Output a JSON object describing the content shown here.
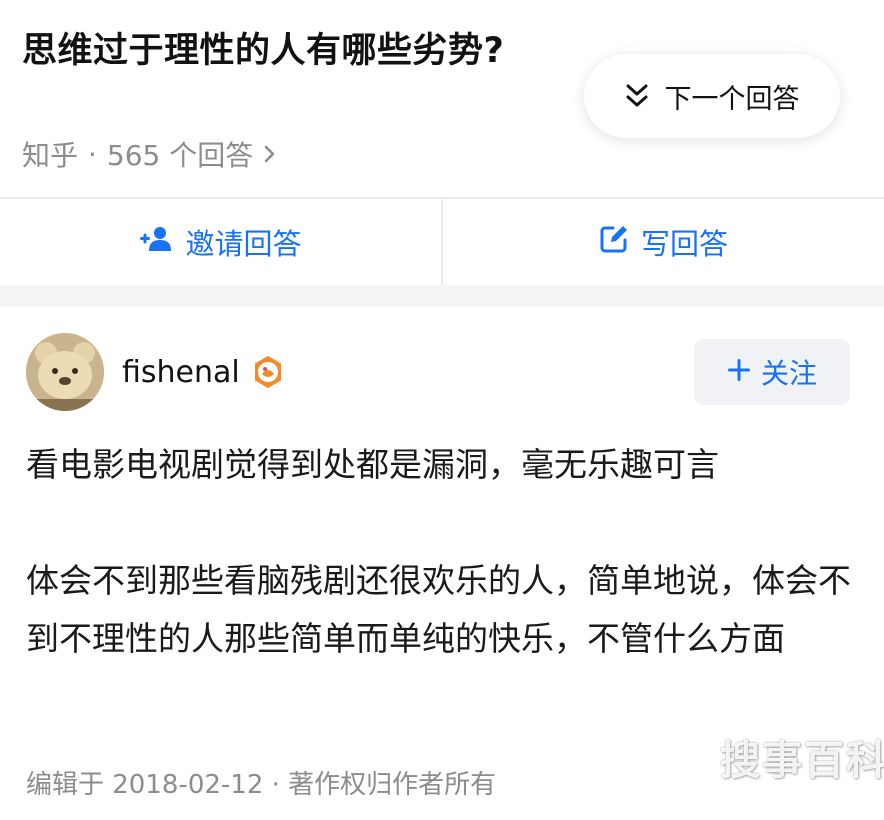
{
  "question": {
    "title": "思维过于理性的人有哪些劣势?",
    "source": "知乎",
    "separator": "·",
    "answer_count": "565 个回答"
  },
  "next_answer": {
    "label": "下一个回答",
    "icon": "double-chevron-down-icon"
  },
  "actions": {
    "invite_label": "邀请回答",
    "invite_icon": "add-person-icon",
    "write_label": "写回答",
    "write_icon": "edit-icon"
  },
  "author": {
    "name": "fishenal",
    "badge_icon": "creator-badge-icon",
    "follow_label": "关注"
  },
  "answer": {
    "paragraphs": [
      "看电影电视剧觉得到处都是漏洞，毫无乐趣可言",
      "体会不到那些看脑残剧还很欢乐的人，简单地说，体会不到不理性的人那些简单而单纯的快乐，不管什么方面"
    ],
    "footer": "编辑于 2018-02-12 · 著作权归作者所有"
  },
  "watermark": "搜事百科",
  "colors": {
    "accent": "#1772f6",
    "muted": "#8c8c8c",
    "badge": "#f28b2c"
  }
}
